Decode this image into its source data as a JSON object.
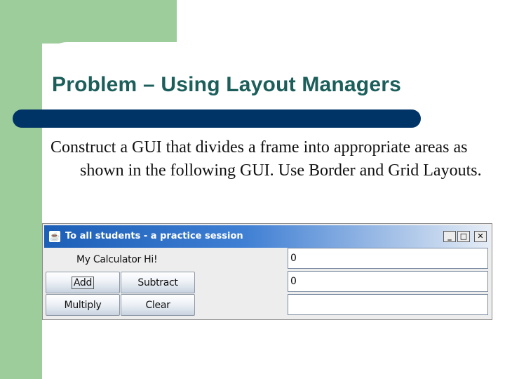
{
  "slide": {
    "title": "Problem – Using Layout Managers",
    "body": "Construct a GUI that divides a frame into appropriate areas as shown in the following GUI. Use Border and Grid Layouts."
  },
  "window": {
    "title": "To all students - a practice session",
    "label": "My Calculator  Hi!",
    "buttons": {
      "add": "Add",
      "subtract": "Subtract",
      "multiply": "Multiply",
      "clear": "Clear"
    },
    "fields": [
      "0",
      "0",
      ""
    ]
  },
  "colors": {
    "green_accent": "#9dcd9a",
    "title_text": "#1b5e5a",
    "title_bar": "#003366",
    "window_titlebar": "#1c5fb7"
  }
}
